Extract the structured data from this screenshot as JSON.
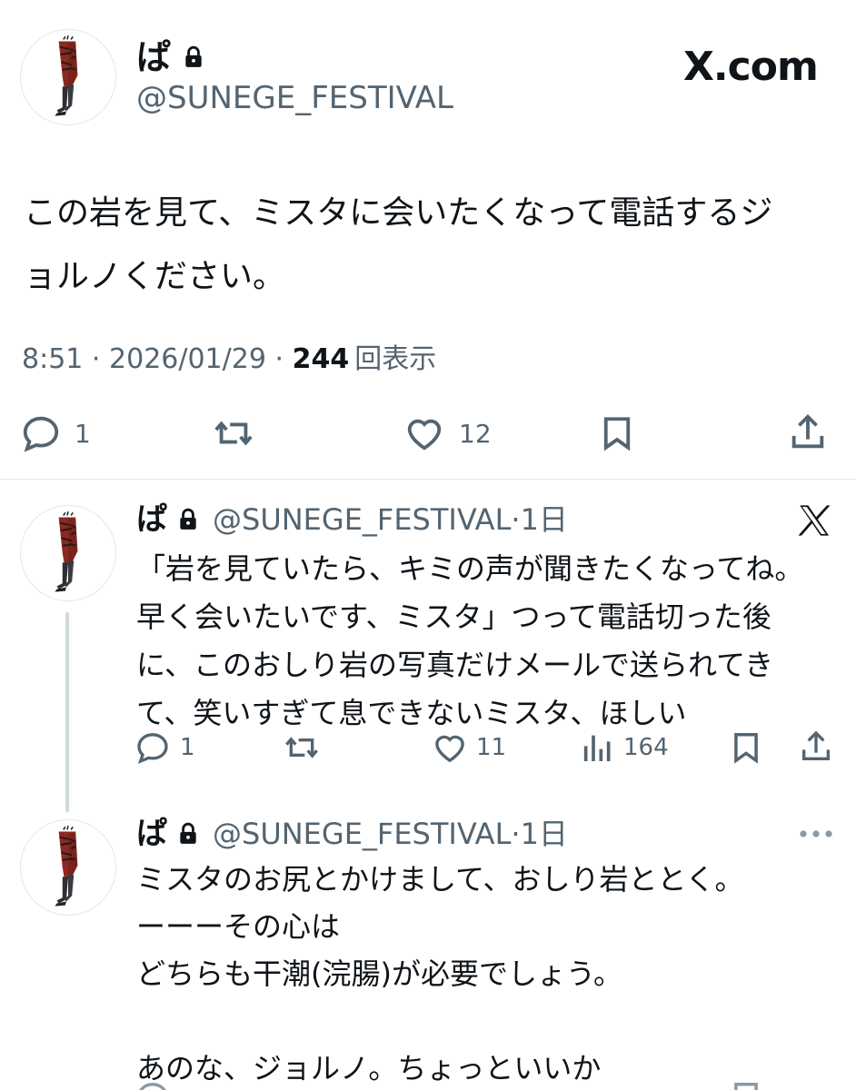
{
  "main": {
    "name": "ぱ",
    "handle": "@SUNEGE_FESTIVAL",
    "brand": "X.com",
    "text": "この岩を見て、ミスタに会いたくなって電話するジ\nョルノください。",
    "time": "8:51",
    "date": "2026/01/29",
    "views_count": "244",
    "views_label": "回表示",
    "sep": "·",
    "replies": "1",
    "likes": "12"
  },
  "reply1": {
    "name": "ぱ",
    "handle": "@SUNEGE_FESTIVAL",
    "age": "·1日",
    "text": "「岩を見ていたら、キミの声が聞きたくなってね。\n早く会いたいです、ミスタ」つって電話切った後\nに、このおしり岩の写真だけメールで送られてき\nて、笑いすぎて息できないミスタ、ほしい",
    "replies": "1",
    "likes": "11",
    "views": "164"
  },
  "reply2": {
    "name": "ぱ",
    "handle": "@SUNEGE_FESTIVAL",
    "age": "·1日",
    "text": "ミスタのお尻とかけまして、おしり岩ととく。\nーーーその心は\nどちらも干潮(浣腸)が必要でしょう。\n\nあのな、ジョルノ。ちょっといいか"
  },
  "icons": [
    "lock-icon",
    "x-logo-icon",
    "reply-icon",
    "retweet-icon",
    "like-icon",
    "bookmark-icon",
    "share-icon",
    "views-icon",
    "more-icon"
  ],
  "colors": {
    "text": "#0f1419",
    "muted": "#536471",
    "divider": "#e1e6ea",
    "thread": "#cfd9de",
    "avatar_red": "#8b2a22"
  }
}
